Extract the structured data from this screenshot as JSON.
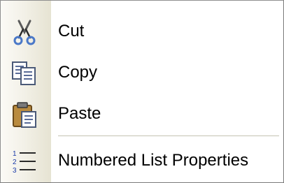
{
  "context_menu": {
    "items": [
      {
        "id": "cut",
        "label": "Cut",
        "icon": "scissors-icon"
      },
      {
        "id": "copy",
        "label": "Copy",
        "icon": "copy-icon"
      },
      {
        "id": "paste",
        "label": "Paste",
        "icon": "paste-icon"
      },
      {
        "id": "numbered_list_properties",
        "label": "Numbered List Properties",
        "icon": "numbered-list-icon"
      }
    ]
  }
}
